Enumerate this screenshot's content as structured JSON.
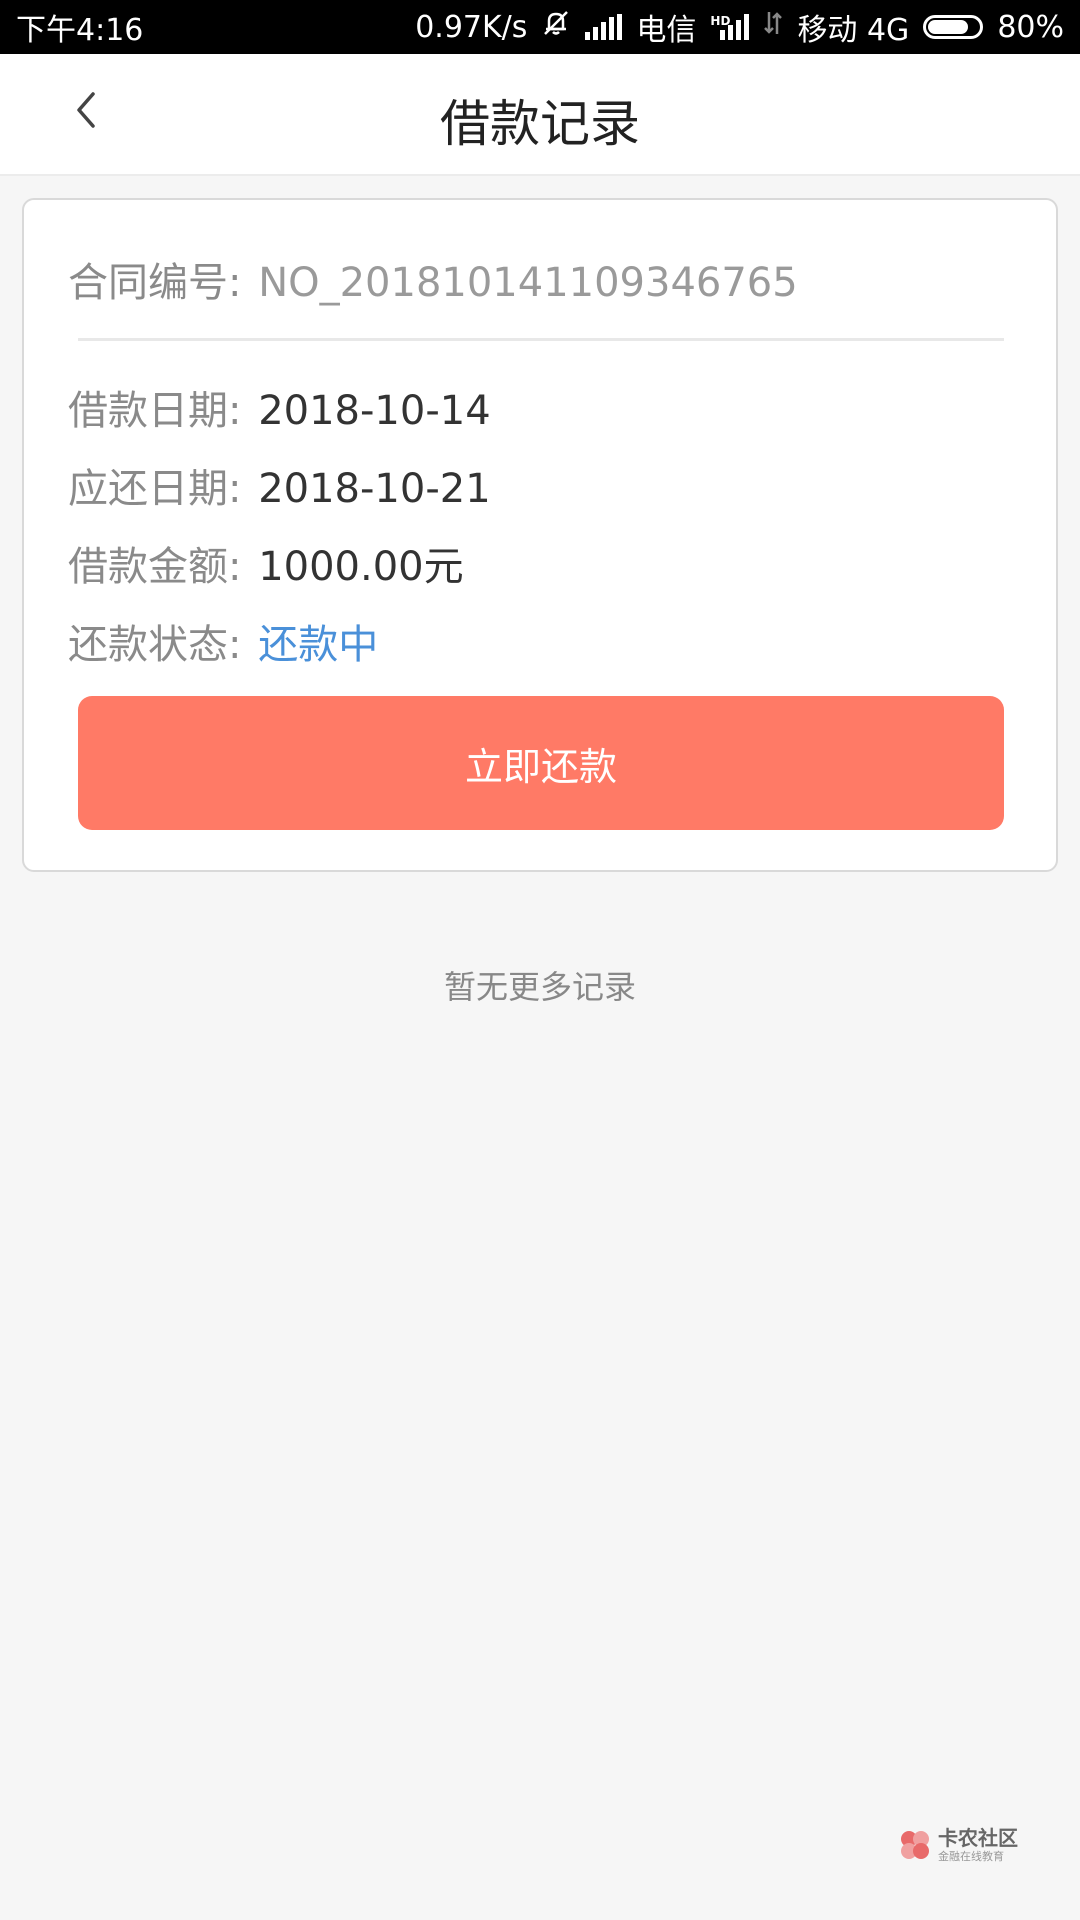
{
  "status_bar": {
    "time": "下午4:16",
    "speed": "0.97K/s",
    "carrier1": "电信",
    "hd": "HD",
    "carrier2": "移动 4G",
    "battery_level": 0.8,
    "battery_text": "80%"
  },
  "nav": {
    "title": "借款记录"
  },
  "record": {
    "contract_label": "合同编号:",
    "contract_value": "NO_201810141109346765",
    "loan_date_label": "借款日期:",
    "loan_date_value": "2018-10-14",
    "due_date_label": "应还日期:",
    "due_date_value": "2018-10-21",
    "amount_label": "借款金额:",
    "amount_value": "1000.00元",
    "status_label": "还款状态:",
    "status_value": "还款中",
    "repay_button": "立即还款"
  },
  "footer": {
    "no_more": "暂无更多记录"
  },
  "watermark": {
    "brand": "卡农社区",
    "tagline": "金融在线教育"
  },
  "colors": {
    "button": "#ff7a66",
    "status": "#4a90d9"
  }
}
